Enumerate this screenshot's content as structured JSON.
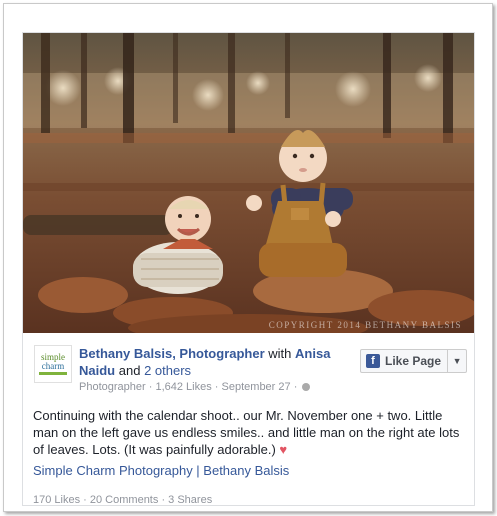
{
  "post": {
    "page_name": "Bethany Balsis, Photographer",
    "with_text": "with",
    "tagged_person": "Anisa Naidu",
    "and_text": "and",
    "others_text": "2 others",
    "category": "Photographer",
    "likes_count": "1,642 Likes",
    "date": "September 27",
    "separator": "·",
    "body": "Continuing with the calendar shoot.. our Mr. November one + two. Little man on the left gave us endless smiles.. and little man on the right ate lots of leaves. Lots. (It was painfully adorable.)",
    "heart": "♥",
    "link_text": "Simple Charm Photography | Bethany Balsis",
    "stats": {
      "likes": "170 Likes",
      "comments": "20 Comments",
      "shares": "3 Shares"
    }
  },
  "avatar": {
    "line1": "simple",
    "line2": "charm"
  },
  "like_button": {
    "label": "Like Page",
    "icon": "f",
    "dropdown": "▼"
  },
  "photo": {
    "watermark": "COPYRIGHT 2014 BETHANY BALSIS"
  }
}
